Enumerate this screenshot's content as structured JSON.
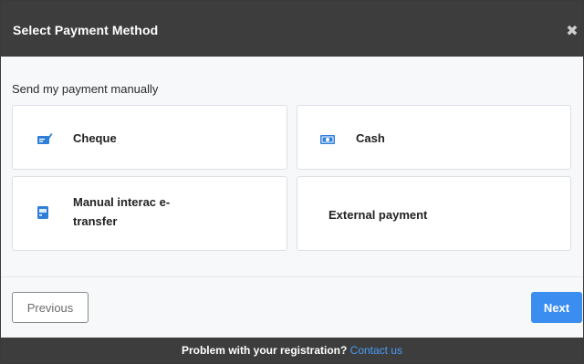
{
  "modal": {
    "title": "Select Payment Method",
    "close_symbol": "✖"
  },
  "body": {
    "section_label": "Send my payment manually",
    "options": [
      {
        "label": "Cheque",
        "icon": "cheque-icon"
      },
      {
        "label": "Cash",
        "icon": "cash-icon"
      },
      {
        "label": "Manual interac e-transfer",
        "icon": "e-transfer-icon"
      },
      {
        "label": "External payment",
        "icon": ""
      }
    ]
  },
  "footer": {
    "previous_label": "Previous",
    "next_label": "Next"
  },
  "bottom_bar": {
    "text": "Problem with your registration?",
    "link_text": "Contact us"
  },
  "colors": {
    "header_bg": "#3d3d3d",
    "accent_blue": "#3b8df0",
    "link_blue": "#4a9df8",
    "icon_blue": "#2f7fd9"
  }
}
